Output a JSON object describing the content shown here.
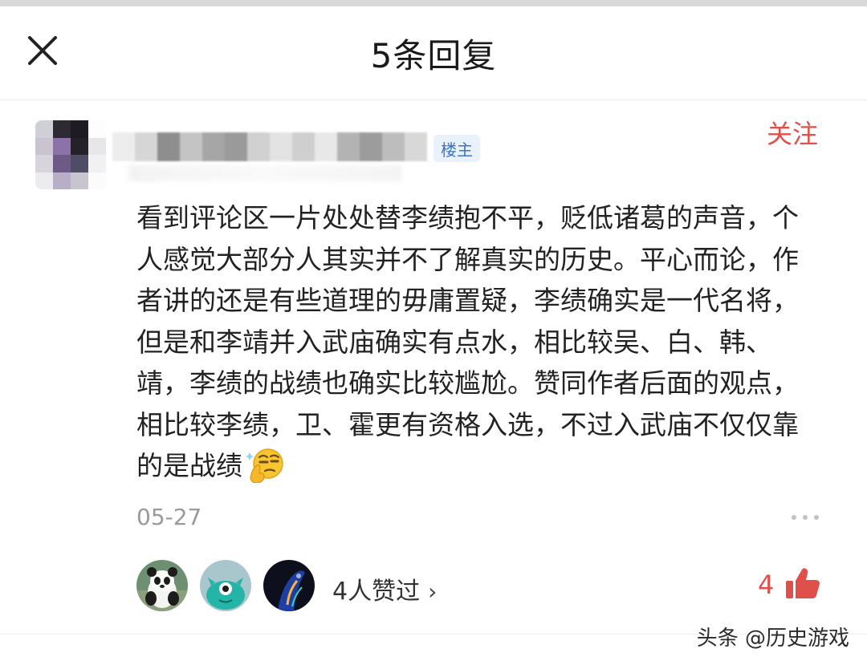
{
  "header": {
    "title": "5条回复"
  },
  "author": {
    "badge": "楼主",
    "follow_label": "关注"
  },
  "comment": {
    "text": "看到评论区一片处处替李绩抱不平，贬低诸葛的声音，个人感觉大部分人其实并不了解真实的历史。平心而论，作者讲的还是有些道理的毋庸置疑，李绩确实是一代名将，但是和李靖并入武庙确实有点水，相比较吴、白、韩、靖，李绩的战绩也确实比较尴尬。赞同作者后面的观点，相比较李绩，卫、霍更有资格入选，不过入武庙不仅仅靠的是战绩",
    "emoji": "thinking-face-icon",
    "date": "05-27"
  },
  "likes": {
    "liked_by_text": "4人赞过",
    "count": "4"
  },
  "watermark": "头条 @历史游戏",
  "colors": {
    "accent_red": "#e0504a",
    "badge_blue": "#3d74c4",
    "muted_gray": "#9a9a9a"
  }
}
